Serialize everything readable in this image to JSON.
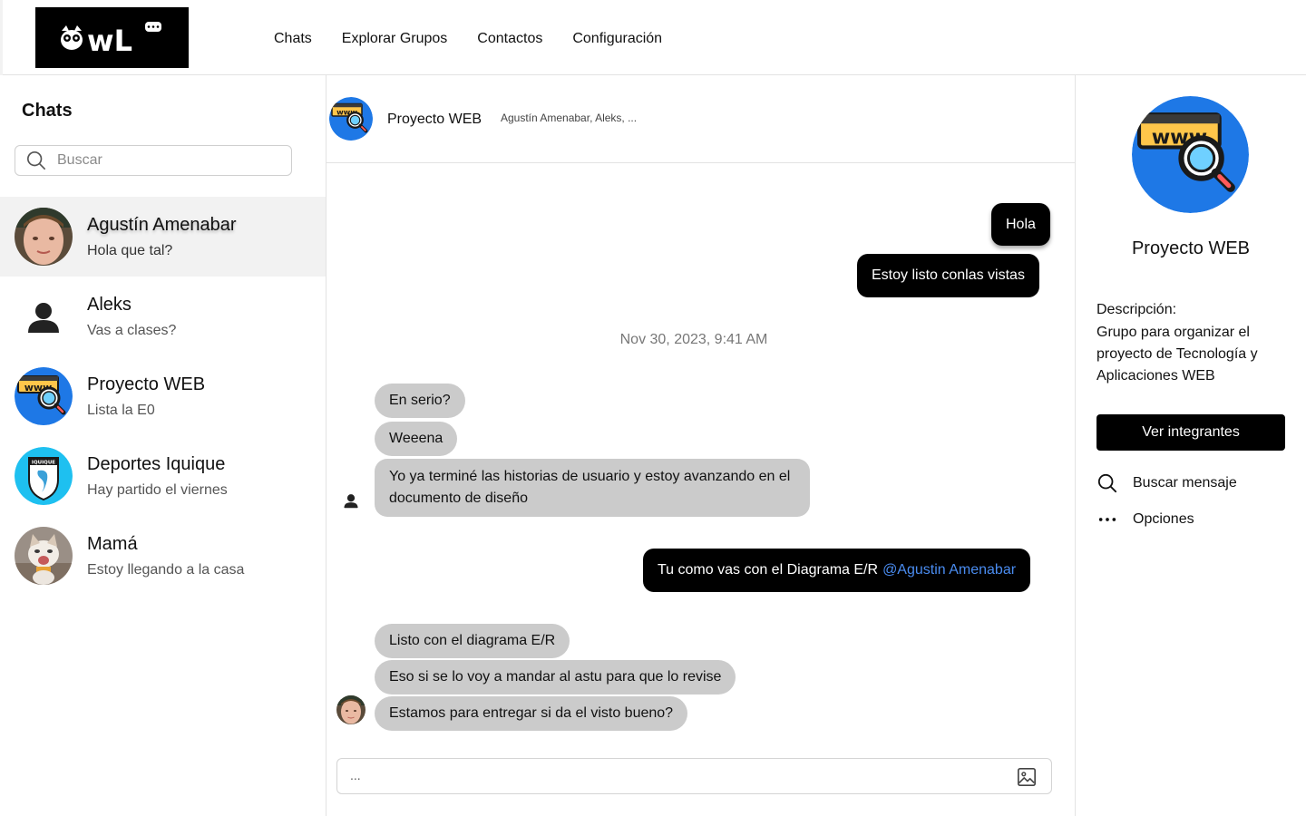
{
  "nav": {
    "logo_text": "wL",
    "items": [
      "Chats",
      "Explorar Grupos",
      "Contactos",
      "Configuración"
    ]
  },
  "sidebar": {
    "title": "Chats",
    "search_placeholder": "Buscar",
    "chats": [
      {
        "name": "Agustín Amenabar",
        "preview": "Hola que tal?",
        "active": true,
        "avatar": "person-photo"
      },
      {
        "name": "Aleks",
        "preview": "Vas a clases?",
        "active": false,
        "avatar": "person-silhouette-icon"
      },
      {
        "name": "Proyecto WEB",
        "preview": "Lista la E0",
        "active": false,
        "avatar": "www-search-icon"
      },
      {
        "name": "Deportes Iquique",
        "preview": "Hay partido el viernes",
        "active": false,
        "avatar": "iquique-badge"
      },
      {
        "name": "Mamá",
        "preview": "Estoy llegando a la casa",
        "active": false,
        "avatar": "cat-photo"
      }
    ]
  },
  "conversation": {
    "title": "Proyecto WEB",
    "members": "Agustín Amenabar, Aleks, ...",
    "messages": [
      {
        "dir": "out",
        "text": "Hola"
      },
      {
        "dir": "out",
        "text": "Estoy listo conlas vistas"
      },
      {
        "type": "timestamp",
        "text": "Nov 30, 2023, 9:41 AM"
      },
      {
        "dir": "in",
        "text": "En serio?"
      },
      {
        "dir": "in",
        "text": "Weeena"
      },
      {
        "dir": "in",
        "text": "Yo ya terminé las historias de usuario y estoy avanzando en el documento de diseño"
      },
      {
        "dir": "out",
        "text": "Tu como vas con el Diagrama E/R",
        "mention": "@Agustin Amenabar"
      },
      {
        "dir": "in",
        "text": "Listo con el diagrama E/R"
      },
      {
        "dir": "in",
        "text": "Eso si se lo voy a mandar al astu para que lo revise"
      },
      {
        "dir": "in",
        "text": "Estamos para entregar si da el visto bueno?"
      }
    ],
    "composer_placeholder": "..."
  },
  "details": {
    "group_name": "Proyecto WEB",
    "description_label": "Descripción:",
    "description": "Grupo para organizar el proyecto de Tecnología y Aplicaciones WEB",
    "members_button": "Ver integrantes",
    "actions": [
      "Buscar mensaje",
      "Opciones"
    ]
  },
  "colors": {
    "outgoing_bubble": "#000000",
    "incoming_bubble": "#cbcbcb",
    "mention": "#4a8cf0",
    "active_chat_bg": "#f2f2f2",
    "www_icon_blue": "#1e78e6",
    "www_icon_yellow": "#ffc64a"
  }
}
